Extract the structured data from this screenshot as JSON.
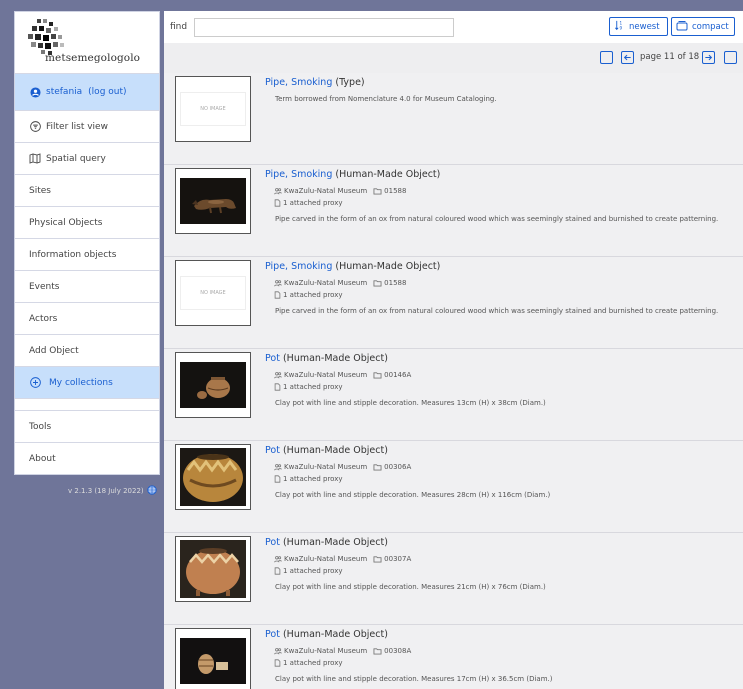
{
  "app": {
    "name": "metsemegologolo",
    "version": "v 2.1.3 (18 July 2022)"
  },
  "sidebar": {
    "user": {
      "name": "stefania",
      "logout": "(log out)"
    },
    "items": [
      {
        "label": "Filter list view",
        "icon": "filter-icon"
      },
      {
        "label": "Spatial query",
        "icon": "map-icon"
      },
      {
        "label": "Sites"
      },
      {
        "label": "Physical Objects"
      },
      {
        "label": "Information objects"
      },
      {
        "label": "Events"
      },
      {
        "label": "Actors"
      },
      {
        "label": "Add Object"
      },
      {
        "label": "My collections",
        "icon": "plus-circle-icon",
        "active": true
      },
      {
        "label": "Tools"
      },
      {
        "label": "About"
      }
    ]
  },
  "toolbar": {
    "find_label": "find",
    "find_value": "",
    "newest_label": "newest",
    "compact_label": "compact"
  },
  "pager": {
    "page_label": "page 11 of 18"
  },
  "records": [
    {
      "name": "Pipe, Smoking",
      "type": "(Type)",
      "thumb": "noimg",
      "description": "Term borrowed from Nomenclature 4.0 for Museum Cataloging."
    },
    {
      "name": "Pipe, Smoking",
      "type": "(Human-Made Object)",
      "thumb": "pipe",
      "museum": "KwaZulu-Natal Museum",
      "number": "01588",
      "proxy": "1 attached proxy",
      "description": "Pipe carved in the form of an ox from natural coloured wood which was seemingly stained and burnished to create patterning."
    },
    {
      "name": "Pipe, Smoking",
      "type": "(Human-Made Object)",
      "thumb": "noimg",
      "museum": "KwaZulu-Natal Museum",
      "number": "01588",
      "proxy": "1 attached proxy",
      "description": "Pipe carved in the form of an ox from natural coloured wood which was seemingly stained and burnished to create patterning."
    },
    {
      "name": "Pot",
      "type": "(Human-Made Object)",
      "thumb": "pots-small",
      "museum": "KwaZulu-Natal Museum",
      "number": "00146A",
      "proxy": "1 attached proxy",
      "description": "Clay pot with line and stipple decoration. Measures 13cm (H) x 38cm (Diam.)"
    },
    {
      "name": "Pot",
      "type": "(Human-Made Object)",
      "thumb": "pot-large",
      "museum": "KwaZulu-Natal Museum",
      "number": "00306A",
      "proxy": "1 attached proxy",
      "description": "Clay pot with line and stipple decoration. Measures 28cm (H) x 116cm (Diam.)"
    },
    {
      "name": "Pot",
      "type": "(Human-Made Object)",
      "thumb": "pot-medium",
      "museum": "KwaZulu-Natal Museum",
      "number": "00307A",
      "proxy": "1 attached proxy",
      "description": "Clay pot with line and stipple decoration. Measures 21cm (H) x 76cm (Diam.)"
    },
    {
      "name": "Pot",
      "type": "(Human-Made Object)",
      "thumb": "pot-small-2",
      "museum": "KwaZulu-Natal Museum",
      "number": "00308A",
      "proxy": "1 attached proxy",
      "description": "Clay pot with line and stipple decoration. Measures 17cm (H) x 36.5cm (Diam.)"
    }
  ],
  "no_image_text": "NO IMAGE",
  "colors": {
    "accent": "#1a5fd0",
    "active_bg": "#c7dffb",
    "background": "#6f7599"
  }
}
